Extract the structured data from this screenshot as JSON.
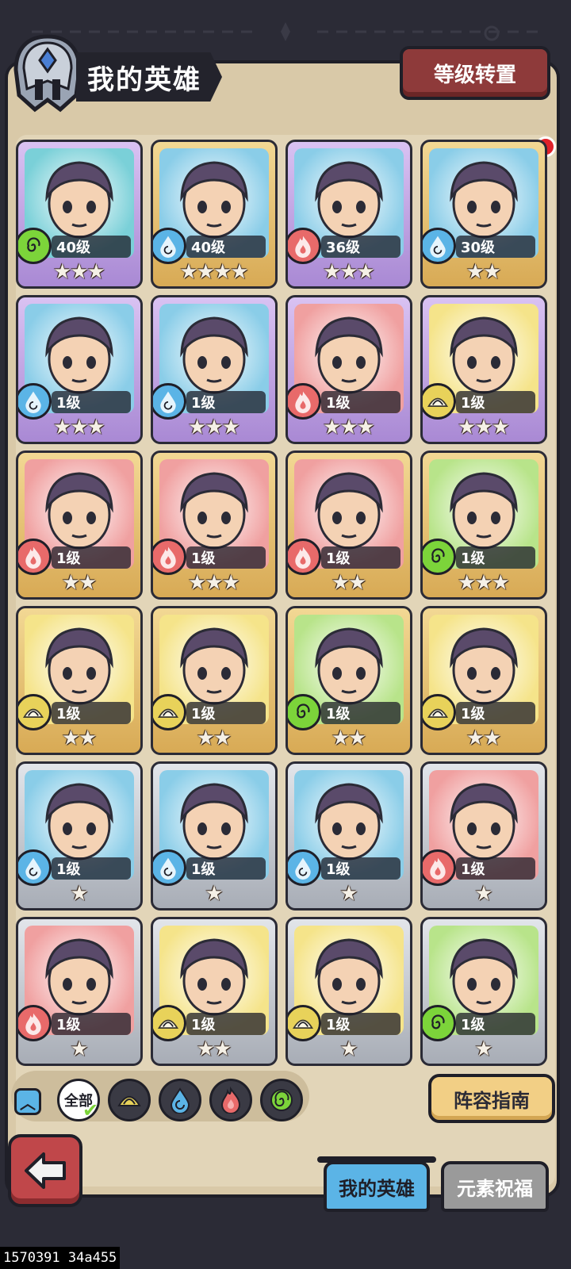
{
  "header": {
    "title": "我的英雄",
    "transfer_label": "等级转置"
  },
  "colors": {
    "water": "#5bb4e6",
    "fire": "#e86a6a",
    "wind": "#7cd43a",
    "earth": "#e8d25a",
    "rarity_purple": "#c7a8e8",
    "rarity_gold": "#e8c275",
    "rarity_silver": "#c8ccd2"
  },
  "heroes": [
    {
      "level": "40级",
      "element": "wind-icon",
      "stars": 3,
      "rarity": "purple",
      "bg": "#7ad0d8"
    },
    {
      "level": "40级",
      "element": "water-icon",
      "stars": 4,
      "rarity": "gold",
      "bg": "#8acde8"
    },
    {
      "level": "36级",
      "element": "fire-icon",
      "stars": 3,
      "rarity": "purple",
      "bg": "#8acde8"
    },
    {
      "level": "30级",
      "element": "water-icon",
      "stars": 2,
      "rarity": "gold",
      "bg": "#8acde8"
    },
    {
      "level": "1级",
      "element": "water-icon",
      "stars": 3,
      "rarity": "purple",
      "bg": "#8acde8"
    },
    {
      "level": "1级",
      "element": "water-icon",
      "stars": 3,
      "rarity": "purple",
      "bg": "#8acde8"
    },
    {
      "level": "1级",
      "element": "fire-icon",
      "stars": 3,
      "rarity": "purple",
      "bg": "#f0a0a0"
    },
    {
      "level": "1级",
      "element": "earth-icon",
      "stars": 3,
      "rarity": "purple",
      "bg": "#f5e48a"
    },
    {
      "level": "1级",
      "element": "fire-icon",
      "stars": 2,
      "rarity": "gold",
      "bg": "#f0a0a0"
    },
    {
      "level": "1级",
      "element": "fire-icon",
      "stars": 3,
      "rarity": "gold",
      "bg": "#f0a0a0"
    },
    {
      "level": "1级",
      "element": "fire-icon",
      "stars": 2,
      "rarity": "gold",
      "bg": "#f0a0a0"
    },
    {
      "level": "1级",
      "element": "wind-icon",
      "stars": 3,
      "rarity": "gold",
      "bg": "#b8e48a"
    },
    {
      "level": "1级",
      "element": "earth-icon",
      "stars": 2,
      "rarity": "gold",
      "bg": "#f5e48a"
    },
    {
      "level": "1级",
      "element": "earth-icon",
      "stars": 2,
      "rarity": "gold",
      "bg": "#f5e48a"
    },
    {
      "level": "1级",
      "element": "wind-icon",
      "stars": 2,
      "rarity": "gold",
      "bg": "#b8e48a"
    },
    {
      "level": "1级",
      "element": "earth-icon",
      "stars": 2,
      "rarity": "gold",
      "bg": "#f5e48a"
    },
    {
      "level": "1级",
      "element": "water-icon",
      "stars": 1,
      "rarity": "silver",
      "bg": "#8acde8"
    },
    {
      "level": "1级",
      "element": "water-icon",
      "stars": 1,
      "rarity": "silver",
      "bg": "#8acde8"
    },
    {
      "level": "1级",
      "element": "water-icon",
      "stars": 1,
      "rarity": "silver",
      "bg": "#8acde8"
    },
    {
      "level": "1级",
      "element": "fire-icon",
      "stars": 1,
      "rarity": "silver",
      "bg": "#f0a0a0"
    },
    {
      "level": "1级",
      "element": "fire-icon",
      "stars": 1,
      "rarity": "silver",
      "bg": "#f0a0a0"
    },
    {
      "level": "1级",
      "element": "earth-icon",
      "stars": 2,
      "rarity": "silver",
      "bg": "#f5e48a"
    },
    {
      "level": "1级",
      "element": "earth-icon",
      "stars": 1,
      "rarity": "silver",
      "bg": "#f5e48a"
    },
    {
      "level": "1级",
      "element": "wind-icon",
      "stars": 1,
      "rarity": "silver",
      "bg": "#b8e48a"
    }
  ],
  "filters": {
    "all_label": "全部",
    "elements": [
      "earth-icon",
      "water-icon",
      "fire-icon",
      "wind-icon"
    ]
  },
  "guide_label": "阵容指南",
  "tabs": {
    "heroes": "我的英雄",
    "blessing": "元素祝福"
  },
  "debug_text": "1570391 34a455"
}
